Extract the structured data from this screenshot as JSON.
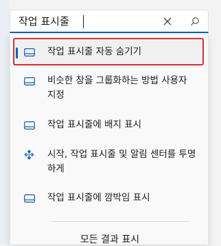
{
  "search": {
    "value": "작업 표시줄",
    "clear_icon": "close-icon",
    "search_icon": "search-icon"
  },
  "results": [
    {
      "label": "작업 표시줄 자동 숨기기",
      "icon": "taskbar-icon",
      "selected": true
    },
    {
      "label": "비슷한 창을 그룹화하는 방법 사용자 지정",
      "icon": "taskbar-icon",
      "selected": false
    },
    {
      "label": "작업 표시줄에 배지 표시",
      "icon": "taskbar-icon",
      "selected": false
    },
    {
      "label": "시작, 작업 표시줄 및 알림 센터를 투명하게",
      "icon": "personalize-icon",
      "selected": false
    },
    {
      "label": "작업 표시줄에 깜박임 표시",
      "icon": "taskbar-icon",
      "selected": false
    }
  ],
  "show_all_label": "모든 결과 표시",
  "colors": {
    "accent": "#0f5fc1",
    "highlight_border": "#d6303a"
  }
}
